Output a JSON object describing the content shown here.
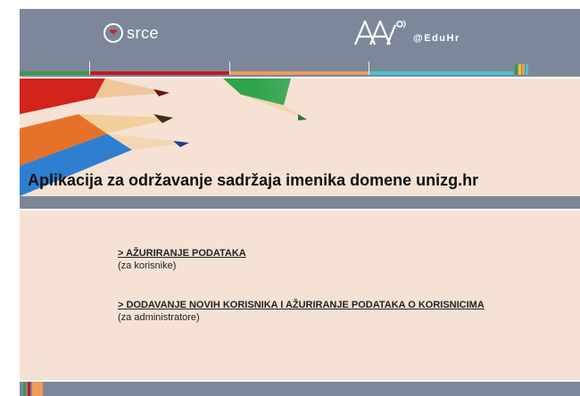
{
  "header": {
    "srce_logo_text": "srce",
    "aai_logo_text": "@EduHr"
  },
  "banner": {
    "title": "Aplikacija za održavanje sadržaja imenika domene unizg.hr"
  },
  "links": [
    {
      "label": "> AŽURIRANJE PODATAKA",
      "subtitle": "(za korisnike)"
    },
    {
      "label": "> DODAVANJE NOVIH KORISNIKA I AŽURIRANJE PODATAKA O KORISNICIMA",
      "subtitle": "(za administratore)"
    }
  ],
  "colors": {
    "header_gray": "#7c889a",
    "content_peach": "#f5e2d5",
    "stripe_green": "#3a9a4b",
    "stripe_red": "#c8171d",
    "stripe_orange": "#f29a59",
    "stripe_cyan": "#46c4d1"
  }
}
